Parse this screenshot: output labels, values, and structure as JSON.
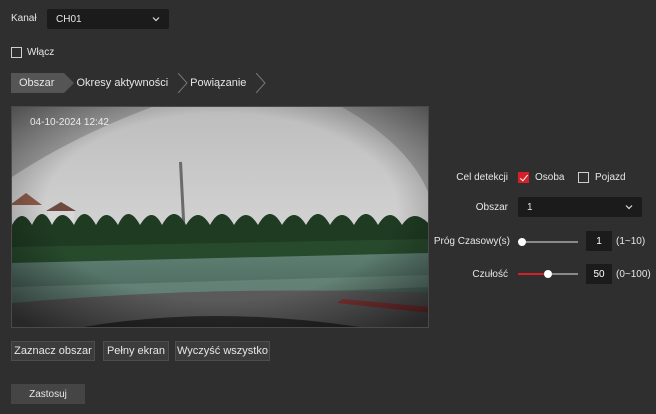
{
  "channel": {
    "label": "Kanał",
    "value": "CH01"
  },
  "enable": {
    "label": "Włącz",
    "checked": false
  },
  "tabs": [
    {
      "label": "Obszar",
      "active": true
    },
    {
      "label": "Okresy aktywności",
      "active": false
    },
    {
      "label": "Powiązanie",
      "active": false
    }
  ],
  "video": {
    "timestamp": "04-10-2024  12:42"
  },
  "detection": {
    "target_label": "Cel detekcji",
    "person": {
      "label": "Osoba",
      "checked": true
    },
    "vehicle": {
      "label": "Pojazd",
      "checked": false
    },
    "area_label": "Obszar",
    "area_value": "1",
    "time_threshold": {
      "label": "Próg Czasowy(s)",
      "value": "1",
      "range": "(1~10)",
      "level": 0.0
    },
    "sensitivity": {
      "label": "Czułość",
      "value": "50",
      "range": "(0~100)",
      "level": 0.5
    }
  },
  "actions": {
    "mark_area": "Zaznacz obszar",
    "fullscreen": "Pełny ekran",
    "clear_all": "Wyczyść wszystko",
    "apply": "Zastosuj"
  },
  "colors": {
    "accent": "#d5202a",
    "background": "#2f2f2f",
    "field": "#1b1b1b"
  }
}
